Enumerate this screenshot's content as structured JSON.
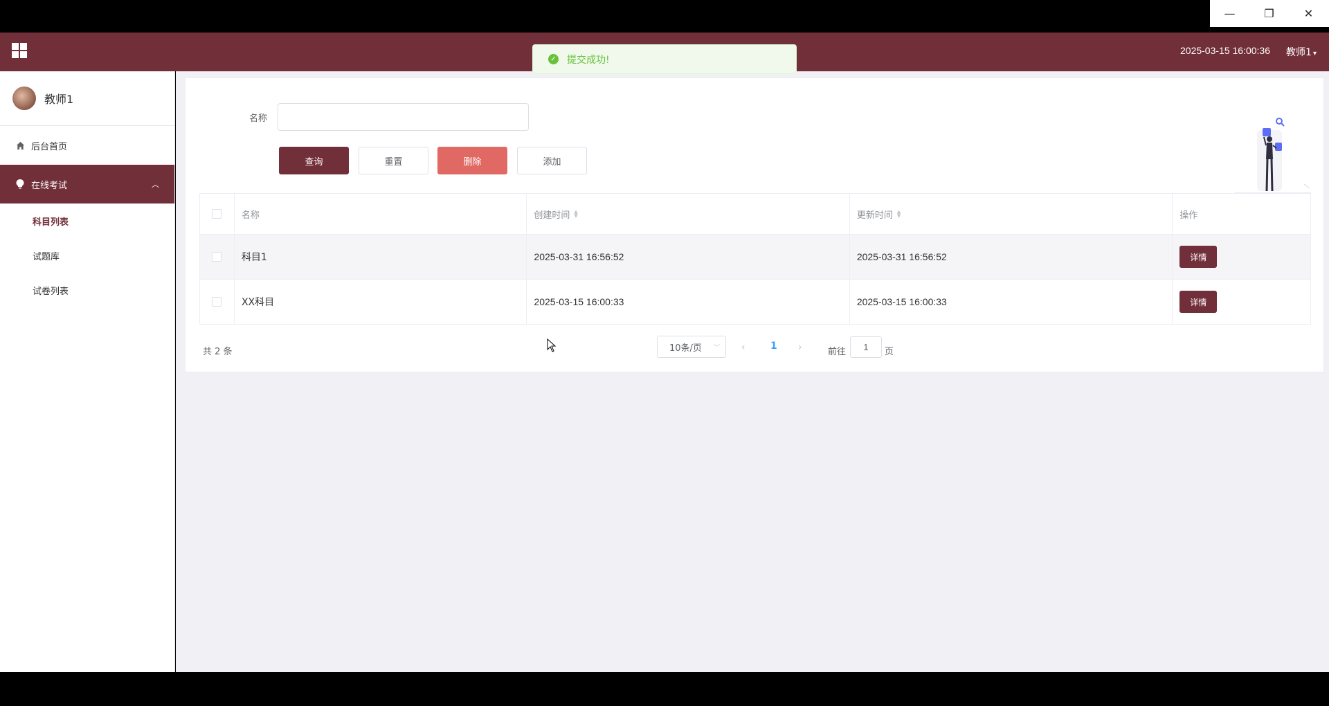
{
  "window": {
    "controls": [
      "—",
      "❐",
      "✕"
    ]
  },
  "header": {
    "datetime": "2025-03-15 16:00:36",
    "user": "教师1"
  },
  "toast": {
    "message": "提交成功!"
  },
  "sidebar": {
    "username": "教师1",
    "items": [
      {
        "label": "后台首页",
        "icon": "home-icon"
      },
      {
        "label": "在线考试",
        "icon": "bulb-icon",
        "active": true,
        "children": [
          "科目列表",
          "试题库",
          "试卷列表"
        ]
      }
    ]
  },
  "search": {
    "label": "名称",
    "value": "",
    "placeholder": ""
  },
  "buttons": {
    "query": "查询",
    "reset": "重置",
    "delete": "删除",
    "add": "添加"
  },
  "table": {
    "headers": [
      "名称",
      "创建时间",
      "更新时间",
      "操作"
    ],
    "rows": [
      {
        "name": "科目1",
        "created": "2025-03-31 16:56:52",
        "updated": "2025-03-31 16:56:52",
        "action": "详情"
      },
      {
        "name": "XX科目",
        "created": "2025-03-15 16:00:33",
        "updated": "2025-03-15 16:00:33",
        "action": "详情"
      }
    ]
  },
  "pagination": {
    "total": "共 2 条",
    "page_size": "10条/页",
    "current_page": "1",
    "goto_label": "前往",
    "goto_value": "1",
    "page_unit": "页"
  },
  "colors": {
    "primary": "#712f39",
    "danger": "#e06a63",
    "success": "#67c23a",
    "link": "#409eff"
  }
}
